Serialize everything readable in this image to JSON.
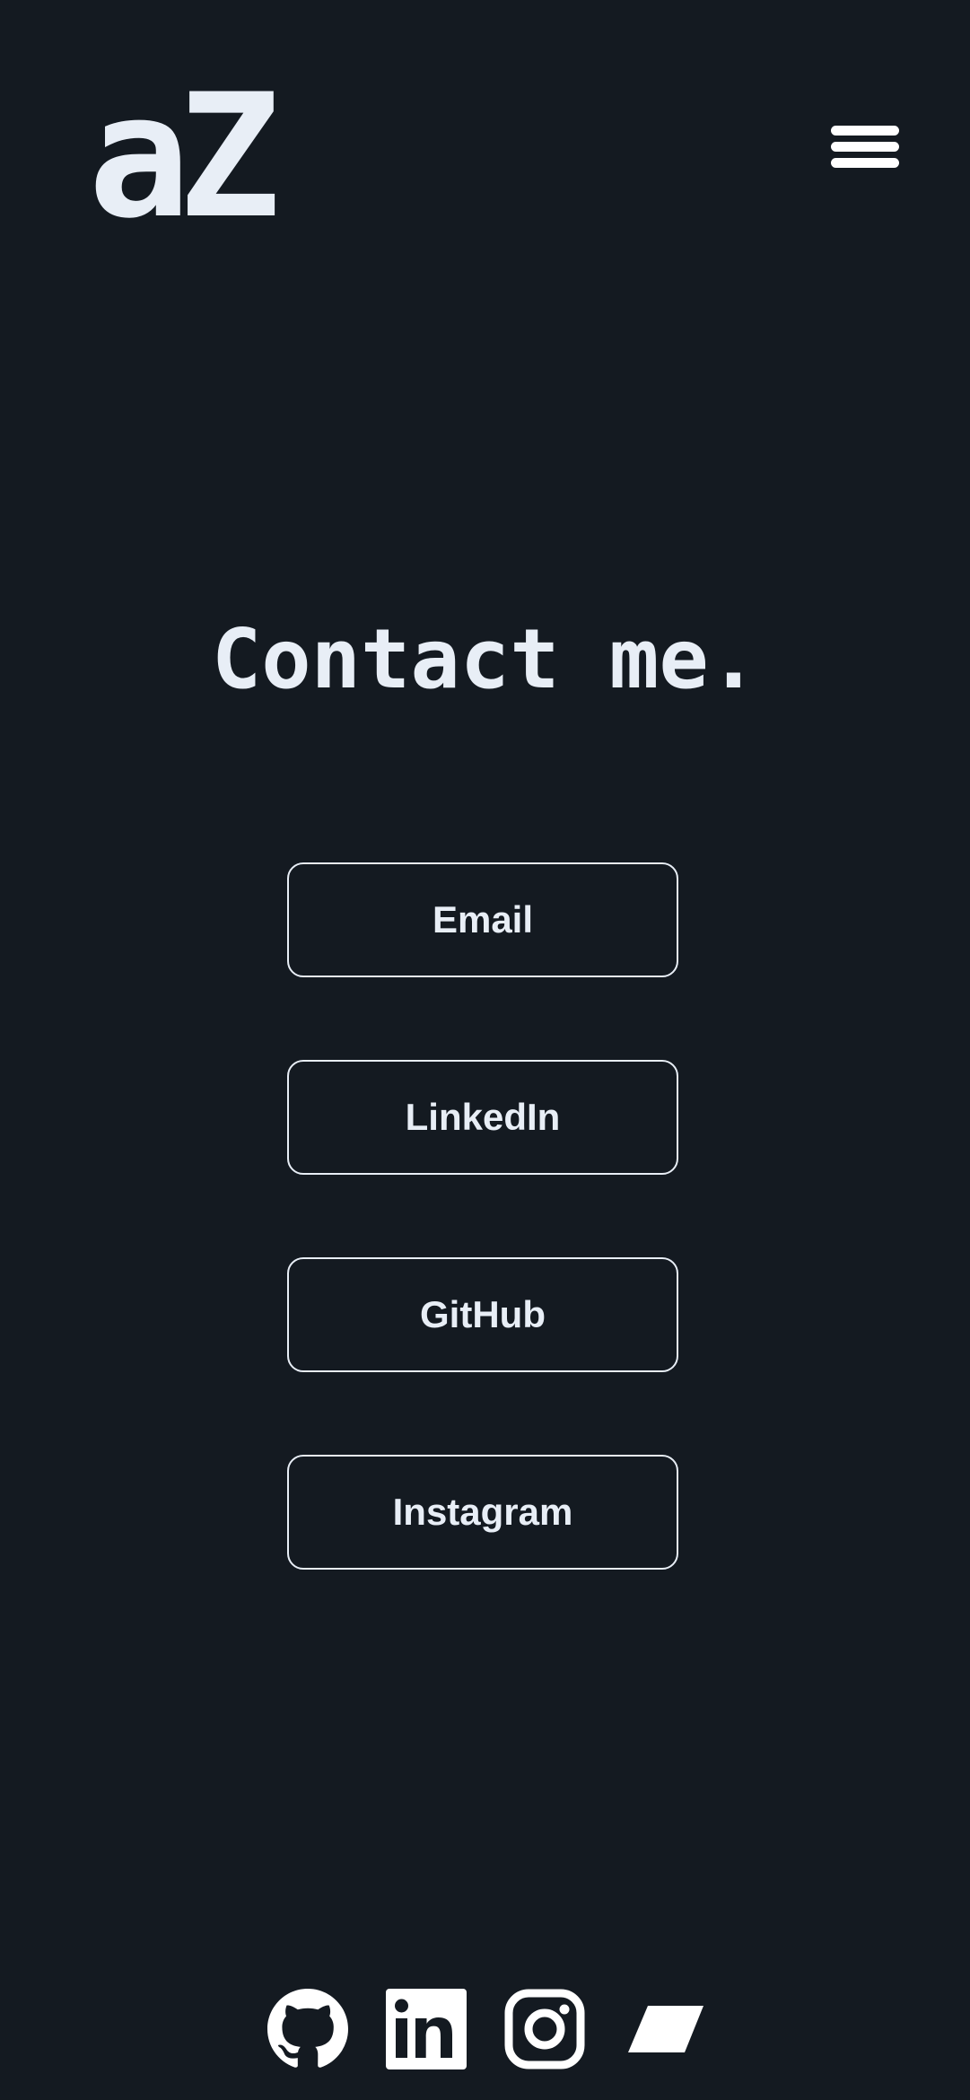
{
  "header": {
    "logo_text": "aZ",
    "menu_icon": "hamburger-menu-icon"
  },
  "main": {
    "title": "Contact me.",
    "buttons": [
      {
        "label": "Email"
      },
      {
        "label": "LinkedIn"
      },
      {
        "label": "GitHub"
      },
      {
        "label": "Instagram"
      }
    ]
  },
  "footer": {
    "social_icons": [
      "github-icon",
      "linkedin-icon",
      "instagram-icon",
      "parallelogram-icon"
    ]
  },
  "colors": {
    "background": "#141a21",
    "foreground": "#e8eef6"
  }
}
